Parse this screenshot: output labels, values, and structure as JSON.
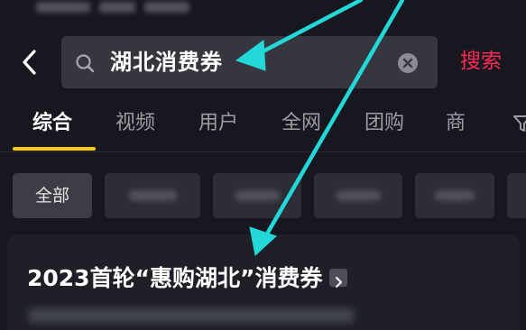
{
  "search": {
    "query": "湖北消费券",
    "submit_label": "搜索"
  },
  "tabs": [
    {
      "label": "综合",
      "active": true
    },
    {
      "label": "视频",
      "active": false
    },
    {
      "label": "用户",
      "active": false
    },
    {
      "label": "全网",
      "active": false
    },
    {
      "label": "团购",
      "active": false
    },
    {
      "label": "商",
      "active": false
    }
  ],
  "chips": [
    {
      "label": "全部",
      "active": true
    }
  ],
  "result": {
    "title": "2023首轮“惠购湖北”消费券"
  },
  "colors": {
    "background": "#17171f",
    "accent_red": "#fe2c55",
    "tab_underline": "#face15",
    "annotation_arrow": "#22d8d8"
  },
  "icons": [
    "back-arrow-icon",
    "search-icon",
    "clear-icon",
    "filter-icon",
    "chevron-right-icon"
  ]
}
